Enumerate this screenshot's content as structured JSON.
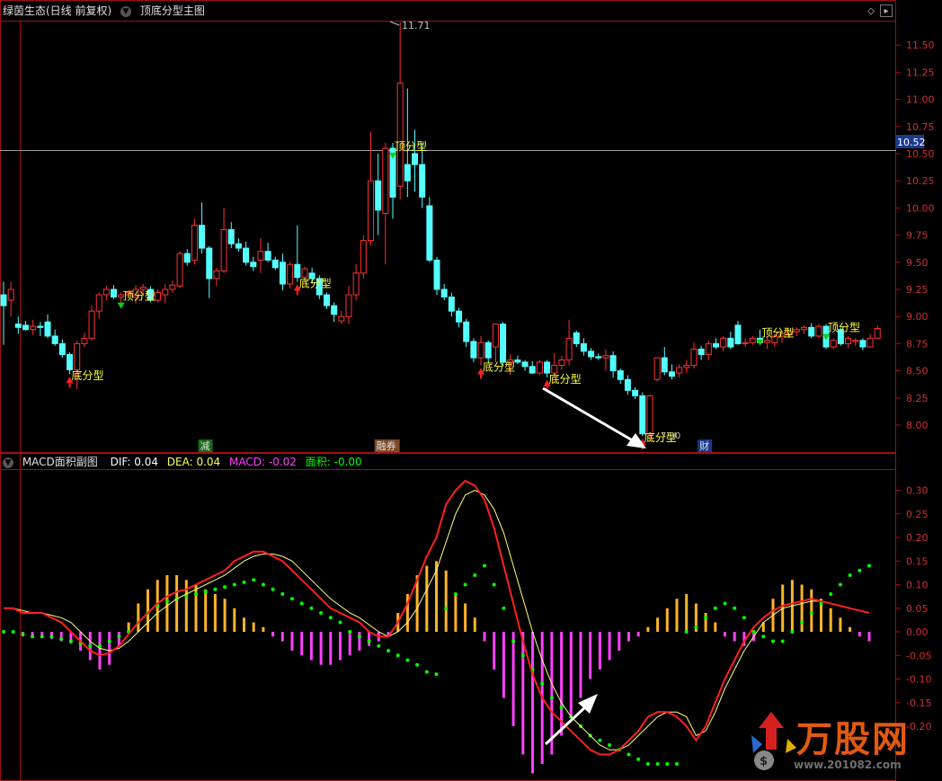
{
  "main_header": {
    "stock_label": "绿茵生态(日线 前复权)",
    "indicator_label": "顶底分型主图"
  },
  "main_price_axis": {
    "ticks": [
      "11.50",
      "11.25",
      "11.00",
      "10.75",
      "10.50",
      "10.25",
      "10.00",
      "9.75",
      "9.50",
      "9.25",
      "9.00",
      "8.75",
      "8.50",
      "8.25",
      "8.00"
    ],
    "current_price": "10.52",
    "high_label": "11.71",
    "low_label": "7.90"
  },
  "main_annotations": {
    "top_label": "顶分型",
    "bottom_label": "底分型",
    "event_markers": [
      "减",
      "融券",
      "财"
    ]
  },
  "sub_header": {
    "title": "MACD面积副图",
    "dif": "DIF: 0.04",
    "dea": "DEA: 0.04",
    "macd": "MACD: -0.02",
    "area": "面积: -0.00"
  },
  "sub_axis": {
    "ticks": [
      "0.30",
      "0.25",
      "0.20",
      "0.15",
      "0.10",
      "0.05",
      "0.00",
      "-0.05",
      "-0.10",
      "-0.15",
      "-0.20"
    ]
  },
  "watermark": {
    "title": "万股网",
    "url": "www.201082.com"
  },
  "colors": {
    "up": "#ff3232",
    "down": "#54ffff",
    "dif": "#ff2020",
    "dea": "#ffff80",
    "macd_pos": "#ffb428",
    "macd_neg": "#ff40ff",
    "area_dots": "#00ff00",
    "grid_red": "#a01010"
  },
  "chart_data": {
    "type": "candlestick",
    "candles": [
      [
        9.2,
        9.32,
        8.74,
        9.1
      ],
      [
        9.15,
        9.32,
        9.0,
        9.25
      ],
      [
        8.93,
        9.0,
        8.84,
        8.9
      ],
      [
        8.92,
        8.96,
        8.87,
        8.88
      ],
      [
        8.88,
        8.97,
        8.83,
        8.91
      ],
      [
        8.91,
        8.95,
        8.82,
        8.9
      ],
      [
        8.95,
        9.02,
        8.8,
        8.82
      ],
      [
        8.82,
        8.88,
        8.73,
        8.75
      ],
      [
        8.75,
        8.79,
        8.62,
        8.65
      ],
      [
        8.65,
        8.67,
        8.47,
        8.51
      ],
      [
        8.51,
        8.78,
        8.33,
        8.75
      ],
      [
        8.75,
        8.85,
        8.72,
        8.8
      ],
      [
        8.8,
        9.1,
        8.78,
        9.05
      ],
      [
        9.05,
        9.22,
        8.98,
        9.2
      ],
      [
        9.2,
        9.28,
        9.15,
        9.25
      ],
      [
        9.25,
        9.29,
        9.16,
        9.18
      ],
      [
        9.18,
        9.22,
        9.13,
        9.2
      ],
      [
        9.2,
        9.24,
        9.17,
        9.22
      ],
      [
        9.18,
        9.29,
        9.12,
        9.25
      ],
      [
        9.25,
        9.3,
        9.2,
        9.27
      ],
      [
        9.25,
        9.28,
        9.13,
        9.15
      ],
      [
        9.15,
        9.25,
        9.13,
        9.22
      ],
      [
        9.2,
        9.3,
        9.12,
        9.25
      ],
      [
        9.25,
        9.33,
        9.22,
        9.29
      ],
      [
        9.28,
        9.6,
        9.26,
        9.58
      ],
      [
        9.58,
        9.62,
        9.47,
        9.5
      ],
      [
        9.52,
        9.9,
        9.48,
        9.84
      ],
      [
        9.84,
        10.05,
        9.58,
        9.63
      ],
      [
        9.63,
        9.65,
        9.17,
        9.35
      ],
      [
        9.35,
        9.45,
        9.28,
        9.42
      ],
      [
        9.42,
        10.0,
        9.4,
        9.8
      ],
      [
        9.8,
        9.87,
        9.63,
        9.67
      ],
      [
        9.67,
        9.72,
        9.6,
        9.63
      ],
      [
        9.63,
        9.69,
        9.47,
        9.5
      ],
      [
        9.5,
        9.55,
        9.42,
        9.46
      ],
      [
        9.52,
        9.72,
        9.4,
        9.6
      ],
      [
        9.6,
        9.68,
        9.5,
        9.52
      ],
      [
        9.52,
        9.55,
        9.43,
        9.45
      ],
      [
        9.5,
        9.58,
        9.24,
        9.3
      ],
      [
        9.3,
        9.5,
        9.26,
        9.48
      ],
      [
        9.48,
        9.84,
        9.32,
        9.36
      ],
      [
        9.36,
        9.46,
        9.31,
        9.44
      ],
      [
        9.4,
        9.45,
        9.3,
        9.35
      ],
      [
        9.35,
        9.38,
        9.16,
        9.2
      ],
      [
        9.2,
        9.22,
        9.07,
        9.1
      ],
      [
        9.1,
        9.13,
        8.95,
        9.02
      ],
      [
        8.96,
        9.05,
        8.93,
        9.0
      ],
      [
        9.0,
        9.28,
        8.93,
        9.2
      ],
      [
        9.2,
        9.48,
        9.15,
        9.4
      ],
      [
        9.4,
        9.75,
        9.35,
        9.7
      ],
      [
        9.7,
        10.7,
        9.65,
        10.25
      ],
      [
        10.25,
        10.5,
        9.75,
        9.98
      ],
      [
        9.95,
        10.6,
        9.48,
        10.55
      ],
      [
        10.55,
        10.6,
        9.9,
        10.1
      ],
      [
        10.2,
        11.71,
        10.08,
        11.15
      ],
      [
        10.4,
        11.1,
        10.1,
        10.25
      ],
      [
        10.5,
        10.72,
        10.15,
        10.4
      ],
      [
        10.4,
        10.6,
        10.0,
        10.1
      ],
      [
        10.02,
        10.1,
        9.5,
        9.52
      ],
      [
        9.52,
        9.55,
        9.2,
        9.25
      ],
      [
        9.25,
        9.3,
        9.15,
        9.18
      ],
      [
        9.18,
        9.22,
        9.0,
        9.05
      ],
      [
        9.05,
        9.08,
        8.9,
        8.95
      ],
      [
        8.95,
        8.98,
        8.72,
        8.77
      ],
      [
        8.77,
        8.8,
        8.58,
        8.62
      ],
      [
        8.62,
        8.82,
        8.55,
        8.76
      ],
      [
        8.76,
        8.78,
        8.58,
        8.62
      ],
      [
        8.72,
        8.93,
        8.58,
        8.93
      ],
      [
        8.93,
        8.95,
        8.55,
        8.58
      ],
      [
        8.58,
        8.65,
        8.46,
        8.6
      ],
      [
        8.6,
        8.64,
        8.56,
        8.58
      ],
      [
        8.58,
        8.6,
        8.5,
        8.54
      ],
      [
        8.54,
        8.59,
        8.47,
        8.48
      ],
      [
        8.48,
        8.6,
        8.46,
        8.58
      ],
      [
        8.58,
        8.6,
        8.44,
        8.48
      ],
      [
        8.48,
        8.66,
        8.45,
        8.55
      ],
      [
        8.55,
        8.64,
        8.51,
        8.6
      ],
      [
        8.6,
        8.97,
        8.55,
        8.8
      ],
      [
        8.85,
        8.87,
        8.72,
        8.75
      ],
      [
        8.75,
        8.8,
        8.64,
        8.68
      ],
      [
        8.68,
        8.71,
        8.6,
        8.63
      ],
      [
        8.63,
        8.66,
        8.6,
        8.62
      ],
      [
        8.62,
        8.7,
        8.5,
        8.64
      ],
      [
        8.64,
        8.68,
        8.44,
        8.5
      ],
      [
        8.5,
        8.52,
        8.38,
        8.42
      ],
      [
        8.42,
        8.46,
        8.28,
        8.32
      ],
      [
        8.32,
        8.35,
        8.24,
        8.27
      ],
      [
        8.27,
        8.3,
        7.9,
        7.92
      ],
      [
        7.92,
        8.28,
        7.85,
        8.27
      ],
      [
        8.42,
        8.62,
        8.4,
        8.62
      ],
      [
        8.62,
        8.72,
        8.46,
        8.49
      ],
      [
        8.49,
        8.56,
        8.42,
        8.45
      ],
      [
        8.48,
        8.56,
        8.44,
        8.53
      ],
      [
        8.53,
        8.6,
        8.48,
        8.55
      ],
      [
        8.55,
        8.76,
        8.52,
        8.7
      ],
      [
        8.7,
        8.73,
        8.6,
        8.65
      ],
      [
        8.65,
        8.78,
        8.6,
        8.75
      ],
      [
        8.75,
        8.8,
        8.7,
        8.72
      ],
      [
        8.72,
        8.82,
        8.68,
        8.8
      ],
      [
        8.8,
        8.86,
        8.7,
        8.72
      ],
      [
        8.92,
        8.96,
        8.74,
        8.75
      ],
      [
        8.75,
        8.8,
        8.72,
        8.76
      ],
      [
        8.76,
        8.82,
        8.74,
        8.8
      ],
      [
        8.8,
        8.88,
        8.74,
        8.76
      ],
      [
        8.76,
        8.82,
        8.7,
        8.78
      ],
      [
        8.76,
        8.84,
        8.72,
        8.82
      ],
      [
        8.82,
        8.86,
        8.76,
        8.84
      ],
      [
        8.84,
        8.88,
        8.8,
        8.86
      ],
      [
        8.86,
        8.9,
        8.82,
        8.88
      ],
      [
        8.88,
        8.92,
        8.84,
        8.9
      ],
      [
        8.9,
        8.94,
        8.8,
        8.82
      ],
      [
        8.82,
        8.93,
        8.8,
        8.91
      ],
      [
        8.91,
        8.93,
        8.7,
        8.72
      ],
      [
        8.72,
        8.8,
        8.7,
        8.78
      ],
      [
        8.88,
        8.9,
        8.73,
        8.75
      ],
      [
        8.75,
        8.82,
        8.71,
        8.8
      ],
      [
        8.77,
        8.8,
        8.73,
        8.78
      ],
      [
        8.78,
        8.8,
        8.69,
        8.72
      ],
      [
        8.72,
        8.84,
        8.72,
        8.8
      ],
      [
        8.8,
        8.92,
        8.79,
        8.89
      ]
    ],
    "fractals": [
      {
        "i": 9,
        "kind": "bottom"
      },
      {
        "i": 16,
        "kind": "top"
      },
      {
        "i": 40,
        "kind": "bottom"
      },
      {
        "i": 53,
        "kind": "top"
      },
      {
        "i": 65,
        "kind": "bottom"
      },
      {
        "i": 74,
        "kind": "bottom"
      },
      {
        "i": 87,
        "kind": "bottom"
      },
      {
        "i": 103,
        "kind": "top"
      },
      {
        "i": 112,
        "kind": "top"
      }
    ],
    "events": [
      {
        "i": 27,
        "text": "减"
      },
      {
        "i": 51,
        "text": "融券"
      },
      {
        "i": 95,
        "text": "财"
      }
    ],
    "macd": {
      "dif": [
        0.05,
        0.05,
        0.04,
        0.04,
        0.04,
        0.03,
        0.02,
        0.0,
        -0.02,
        -0.04,
        -0.05,
        -0.045,
        -0.03,
        -0.005,
        0.02,
        0.04,
        0.06,
        0.075,
        0.085,
        0.09,
        0.1,
        0.11,
        0.12,
        0.13,
        0.15,
        0.16,
        0.17,
        0.17,
        0.16,
        0.15,
        0.13,
        0.11,
        0.09,
        0.07,
        0.05,
        0.04,
        0.03,
        0.02,
        0.0,
        -0.01,
        -0.01,
        0.02,
        0.06,
        0.11,
        0.16,
        0.2,
        0.27,
        0.3,
        0.32,
        0.31,
        0.28,
        0.22,
        0.14,
        0.06,
        -0.02,
        -0.09,
        -0.14,
        -0.17,
        -0.19,
        -0.21,
        -0.23,
        -0.25,
        -0.26,
        -0.26,
        -0.25,
        -0.23,
        -0.21,
        -0.18,
        -0.17,
        -0.17,
        -0.18,
        -0.2,
        -0.23,
        -0.2,
        -0.15,
        -0.1,
        -0.06,
        -0.02,
        0.01,
        0.03,
        0.045,
        0.055,
        0.06,
        0.065,
        0.07,
        0.065,
        0.06,
        0.055,
        0.05,
        0.045,
        0.04
      ],
      "dea": [
        0.05,
        0.05,
        0.045,
        0.04,
        0.04,
        0.035,
        0.03,
        0.02,
        0.0,
        -0.02,
        -0.035,
        -0.04,
        -0.035,
        -0.02,
        0.0,
        0.02,
        0.04,
        0.055,
        0.07,
        0.08,
        0.09,
        0.1,
        0.11,
        0.12,
        0.135,
        0.15,
        0.16,
        0.165,
        0.165,
        0.16,
        0.15,
        0.13,
        0.11,
        0.09,
        0.07,
        0.055,
        0.04,
        0.03,
        0.015,
        0.0,
        -0.01,
        0.0,
        0.02,
        0.05,
        0.09,
        0.13,
        0.19,
        0.25,
        0.29,
        0.3,
        0.29,
        0.26,
        0.21,
        0.14,
        0.07,
        0.0,
        -0.06,
        -0.11,
        -0.15,
        -0.18,
        -0.2,
        -0.22,
        -0.24,
        -0.25,
        -0.25,
        -0.24,
        -0.22,
        -0.2,
        -0.18,
        -0.17,
        -0.17,
        -0.18,
        -0.22,
        -0.21,
        -0.17,
        -0.12,
        -0.08,
        -0.04,
        -0.01,
        0.02,
        0.035,
        0.05,
        0.055,
        0.06,
        0.065,
        0.065,
        0.06,
        0.055,
        0.05,
        0.045,
        0.04
      ],
      "hist": [
        0.0,
        0.0,
        -0.01,
        -0.01,
        -0.01,
        -0.015,
        -0.02,
        -0.025,
        -0.04,
        -0.06,
        -0.08,
        -0.07,
        -0.03,
        0.02,
        0.06,
        0.09,
        0.11,
        0.12,
        0.12,
        0.11,
        0.1,
        0.09,
        0.08,
        0.07,
        0.05,
        0.03,
        0.02,
        0.01,
        -0.01,
        -0.02,
        -0.04,
        -0.05,
        -0.06,
        -0.07,
        -0.07,
        -0.06,
        -0.05,
        -0.04,
        -0.03,
        -0.02,
        -0.01,
        0.04,
        0.08,
        0.12,
        0.14,
        0.15,
        0.13,
        0.08,
        0.06,
        0.03,
        -0.02,
        -0.08,
        -0.14,
        -0.2,
        -0.26,
        -0.3,
        -0.28,
        -0.26,
        -0.22,
        -0.18,
        -0.14,
        -0.1,
        -0.08,
        -0.06,
        -0.04,
        -0.02,
        -0.01,
        0.01,
        0.03,
        0.05,
        0.07,
        0.08,
        0.06,
        0.04,
        0.02,
        -0.01,
        -0.02,
        -0.03,
        -0.02,
        0.02,
        0.07,
        0.1,
        0.11,
        0.1,
        0.09,
        0.07,
        0.05,
        0.03,
        0.01,
        -0.01,
        -0.02
      ],
      "area_dots": [
        0.0,
        0.0,
        -0.005,
        -0.01,
        -0.01,
        -0.01,
        -0.015,
        -0.02,
        -0.025,
        -0.03,
        -0.03,
        -0.02,
        -0.01,
        0.0,
        0.02,
        0.04,
        0.055,
        0.065,
        0.07,
        0.075,
        0.08,
        0.085,
        0.09,
        0.095,
        0.1,
        0.105,
        0.11,
        0.1,
        0.09,
        0.08,
        0.07,
        0.06,
        0.05,
        0.04,
        0.03,
        0.02,
        0.0,
        -0.01,
        -0.02,
        -0.03,
        -0.04,
        -0.05,
        -0.06,
        -0.07,
        -0.085,
        -0.09,
        0.05,
        0.08,
        0.1,
        0.12,
        0.14,
        0.1,
        0.05,
        -0.02,
        -0.05,
        -0.08,
        -0.11,
        -0.14,
        -0.16,
        -0.18,
        -0.2,
        -0.22,
        -0.23,
        -0.24,
        -0.25,
        -0.26,
        -0.27,
        -0.28,
        -0.28,
        -0.28,
        -0.28,
        0.0,
        0.01,
        0.03,
        0.05,
        0.06,
        0.05,
        0.03,
        0.0,
        -0.01,
        -0.02,
        -0.02,
        0.0,
        0.02,
        0.04,
        0.06,
        0.08,
        0.1,
        0.12,
        0.13,
        0.14
      ]
    }
  }
}
